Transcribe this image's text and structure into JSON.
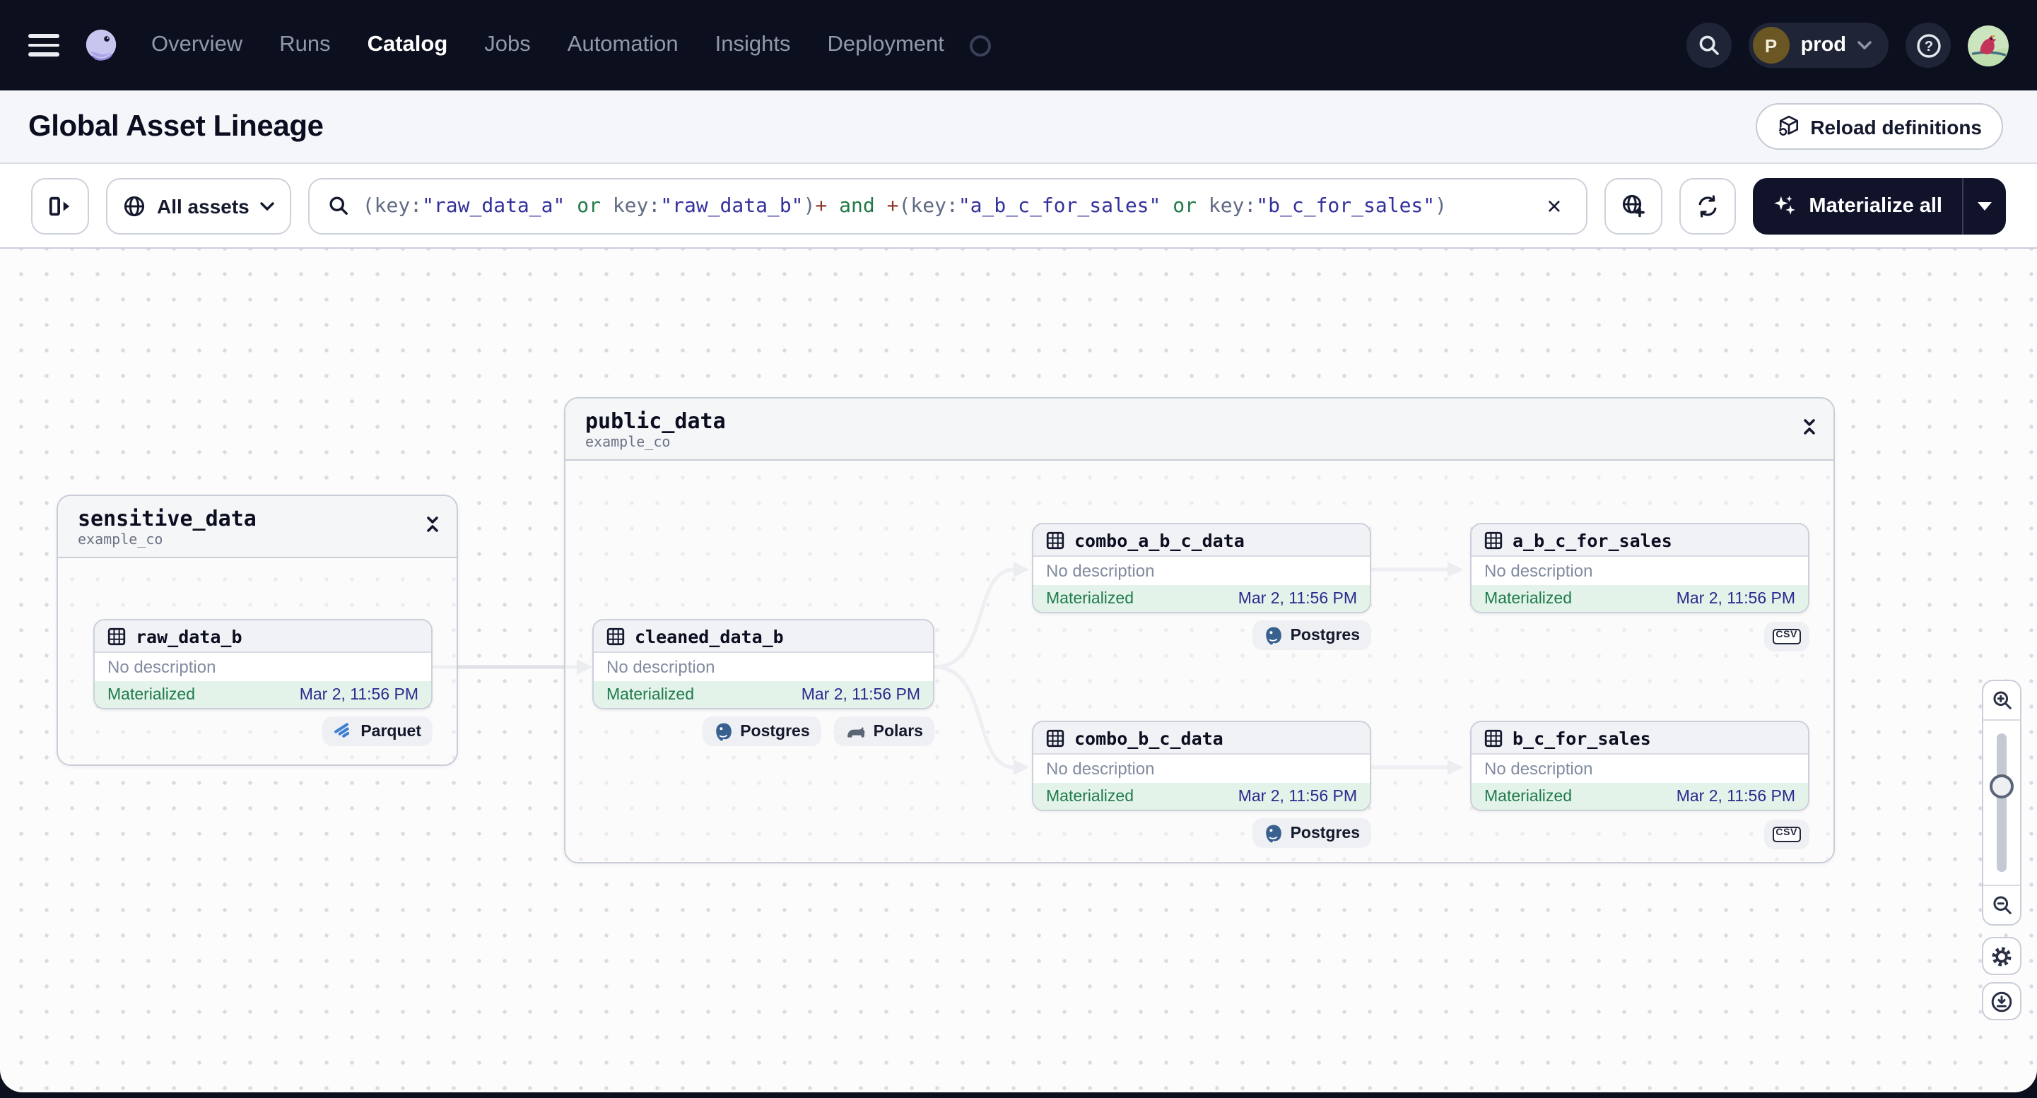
{
  "nav": {
    "items": [
      {
        "label": "Overview",
        "active": false
      },
      {
        "label": "Runs",
        "active": false
      },
      {
        "label": "Catalog",
        "active": true
      },
      {
        "label": "Jobs",
        "active": false
      },
      {
        "label": "Automation",
        "active": false
      },
      {
        "label": "Insights",
        "active": false
      },
      {
        "label": "Deployment",
        "active": false
      }
    ],
    "environment": {
      "initial": "P",
      "name": "prod"
    }
  },
  "header": {
    "title": "Global Asset Lineage",
    "reload_button": "Reload definitions"
  },
  "toolbar": {
    "asset_filter_label": "All assets",
    "materialize_button": "Materialize all",
    "clear_label": "×",
    "query_tokens": [
      {
        "text": "(key:",
        "type": "punct"
      },
      {
        "text": "\"raw_data_a\"",
        "type": "value"
      },
      {
        "text": " or ",
        "type": "op"
      },
      {
        "text": "key:",
        "type": "punct"
      },
      {
        "text": "\"raw_data_b\"",
        "type": "value"
      },
      {
        "text": ")",
        "type": "punct"
      },
      {
        "text": "+",
        "type": "plus"
      },
      {
        "text": " and ",
        "type": "op"
      },
      {
        "text": "+",
        "type": "plus"
      },
      {
        "text": "(key:",
        "type": "punct"
      },
      {
        "text": "\"a_b_c_for_sales\"",
        "type": "value"
      },
      {
        "text": " or ",
        "type": "op"
      },
      {
        "text": "key:",
        "type": "punct"
      },
      {
        "text": "\"b_c_for_sales\"",
        "type": "value"
      },
      {
        "text": ")",
        "type": "punct"
      }
    ]
  },
  "graph": {
    "groups": [
      {
        "name": "sensitive_data",
        "repo": "example_co"
      },
      {
        "name": "public_data",
        "repo": "example_co"
      }
    ],
    "nodes": [
      {
        "name": "raw_data_b",
        "description": "No description",
        "status": "Materialized",
        "timestamp": "Mar 2, 11:56 PM",
        "tags": [
          "Parquet"
        ]
      },
      {
        "name": "cleaned_data_b",
        "description": "No description",
        "status": "Materialized",
        "timestamp": "Mar 2, 11:56 PM",
        "tags": [
          "Postgres",
          "Polars"
        ]
      },
      {
        "name": "combo_a_b_c_data",
        "description": "No description",
        "status": "Materialized",
        "timestamp": "Mar 2, 11:56 PM",
        "tags": [
          "Postgres"
        ]
      },
      {
        "name": "a_b_c_for_sales",
        "description": "No description",
        "status": "Materialized",
        "timestamp": "Mar 2, 11:56 PM",
        "tags": [
          "CSV"
        ]
      },
      {
        "name": "combo_b_c_data",
        "description": "No description",
        "status": "Materialized",
        "timestamp": "Mar 2, 11:56 PM",
        "tags": [
          "Postgres"
        ]
      },
      {
        "name": "b_c_for_sales",
        "description": "No description",
        "status": "Materialized",
        "timestamp": "Mar 2, 11:56 PM",
        "tags": [
          "CSV"
        ]
      }
    ]
  },
  "icons": {
    "nav": [
      "menu-icon",
      "dagster-logo",
      "search-icon",
      "help-icon"
    ],
    "toolbar": [
      "panel-open-icon",
      "globe-icon",
      "search-icon",
      "clear-icon",
      "globe-add-icon",
      "refresh-icon",
      "sparkle-icon",
      "caret-down-icon"
    ],
    "graph": [
      "table-icon",
      "collapse-icon",
      "parquet-icon",
      "postgres-icon",
      "polars-icon",
      "csv-icon"
    ],
    "controls": [
      "zoom-in-icon",
      "zoom-out-icon",
      "settings-icon",
      "download-icon"
    ]
  },
  "colors": {
    "nav_bg": "#0C0F1E",
    "accent_dark": "#10132A",
    "status_green": "#1F7A4C",
    "status_bg": "#E3F3E9",
    "timestamp_blue": "#2A2A8F",
    "edge_gray": "#E0E2E8",
    "postgres_blue": "#39618F",
    "parquet_blue": "#3F7FD1"
  }
}
